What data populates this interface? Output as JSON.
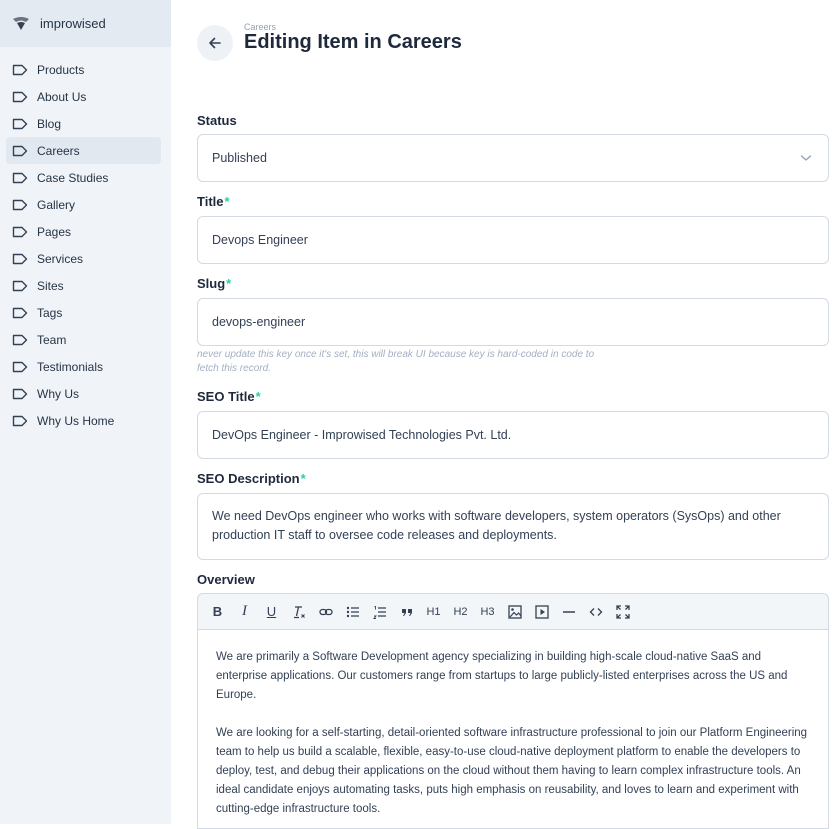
{
  "brand": {
    "name": "improwised"
  },
  "sidebar": {
    "items": [
      {
        "label": "Products"
      },
      {
        "label": "About Us"
      },
      {
        "label": "Blog"
      },
      {
        "label": "Careers"
      },
      {
        "label": "Case Studies"
      },
      {
        "label": "Gallery"
      },
      {
        "label": "Pages"
      },
      {
        "label": "Services"
      },
      {
        "label": "Sites"
      },
      {
        "label": "Tags"
      },
      {
        "label": "Team"
      },
      {
        "label": "Testimonials"
      },
      {
        "label": "Why Us"
      },
      {
        "label": "Why Us Home"
      }
    ],
    "active_item": "Careers"
  },
  "header": {
    "breadcrumb": "Careers",
    "title": "Editing Item in Careers"
  },
  "form": {
    "status": {
      "label": "Status",
      "value": "Published"
    },
    "title": {
      "label": "Title",
      "required_mark": "*",
      "value": "Devops Engineer"
    },
    "slug": {
      "label": "Slug",
      "required_mark": "*",
      "value": "devops-engineer",
      "hint": "never update this key once it's set, this will break UI because key is hard-coded in code to fetch this record."
    },
    "seo_title": {
      "label": "SEO Title",
      "required_mark": "*",
      "value": "DevOps Engineer - Improwised Technologies Pvt. Ltd."
    },
    "seo_description": {
      "label": "SEO Description",
      "required_mark": "*",
      "value": "We need DevOps engineer who works with software developers, system operators (SysOps) and other production IT staff to oversee code releases and deployments."
    },
    "overview": {
      "label": "Overview",
      "toolbar": {
        "bold": "B",
        "italic": "I",
        "underline": "U",
        "h1": "H1",
        "h2": "H2",
        "h3": "H3"
      },
      "paragraphs": [
        "We are primarily a Software Development agency specializing in building high-scale cloud-native SaaS and enterprise applications. Our customers range from startups to large publicly-listed enterprises across the US and Europe.",
        "We are looking for a self-starting, detail-oriented software infrastructure professional to join our Platform Engineering team to help us build a scalable, flexible, easy-to-use cloud-native deployment platform to enable the developers to deploy, test, and debug their applications on the cloud without them having to learn complex infrastructure tools. An ideal candidate enjoys automating tasks, puts high emphasis on reusability, and loves to learn and experiment with cutting-edge infrastructure tools."
      ]
    }
  },
  "colors": {
    "required": "#2ecda7",
    "sidebar_bg": "#f0f4f9"
  }
}
